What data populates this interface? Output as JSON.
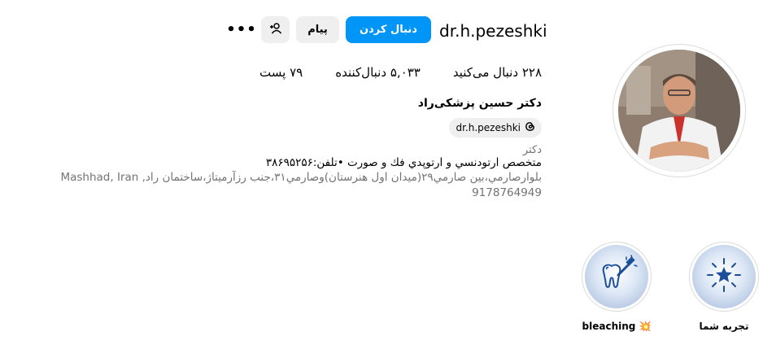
{
  "profile": {
    "username": "dr.h.pezeshki",
    "follow_label": "دنبال کردن",
    "message_label": "پیام",
    "more_label": "•••",
    "stats": [
      {
        "value": "۷۹",
        "label": "پست"
      },
      {
        "value": "۵,۰۳۳",
        "label": "دنبال‌کننده"
      },
      {
        "value": "۲۲۸",
        "label": "دنبال می‌کنید"
      }
    ],
    "full_name": "دکتر حسین پزشکی‌راد",
    "threads_handle": "dr.h.pezeshki",
    "category": "دکتر",
    "bio": "متخصص ارتودنسي و ارتوپدي فك و صورت •تلفن:۳۸۶۹۵۲۵۶",
    "address": "بلوارصارمي،بين صارمي۲۹(ميدان اول هنرستان)وصارمي۳۱،جنب رزآرميتاژ،ساختمان راد, Mashhad, Iran",
    "phone": "9178764949"
  },
  "highlights": [
    {
      "label": "تجربه شما",
      "icon": "star-burst-icon"
    },
    {
      "label": "bleaching 💥",
      "icon": "tooth-brush-icon"
    }
  ],
  "colors": {
    "primary": "#0095f6",
    "secondary_button": "#efefef",
    "muted_text": "#737373",
    "highlight_icon": "#1c4e9a"
  }
}
